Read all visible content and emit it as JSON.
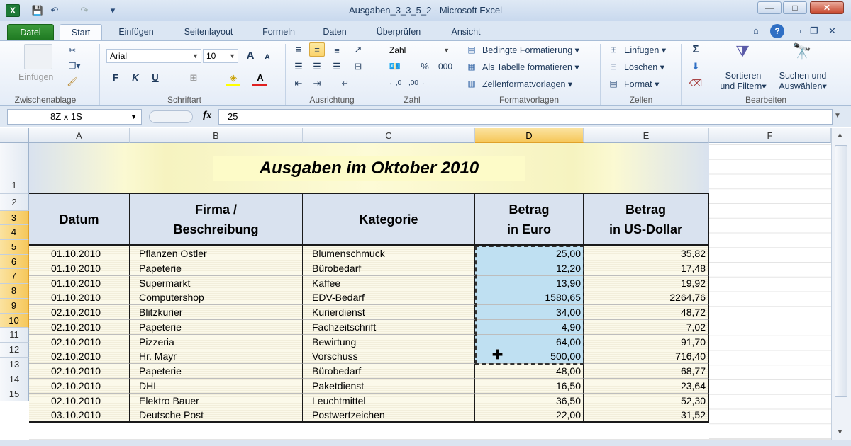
{
  "window": {
    "title": "Ausgaben_3_3_5_2  -  Microsoft Excel",
    "app_icon": "X"
  },
  "qat": {
    "save": "💾",
    "undo": "↶",
    "redo": "↷",
    "customize": "▾"
  },
  "winbtns": {
    "min": "—",
    "max": "□",
    "close": "✕"
  },
  "tabs": [
    "Datei",
    "Start",
    "Einfügen",
    "Seitenlayout",
    "Formeln",
    "Daten",
    "Überprüfen",
    "Ansicht"
  ],
  "ribbon": {
    "clipboard": {
      "paste": "Einfügen",
      "label": "Zwischenablage"
    },
    "font": {
      "name": "Arial",
      "size": "10",
      "bold": "F",
      "italic": "K",
      "underline": "U",
      "grow": "A",
      "shrink": "A",
      "label": "Schriftart"
    },
    "alignment": {
      "label": "Ausrichtung"
    },
    "number": {
      "format": "Zahl",
      "percent": "%",
      "thousands": "000",
      "label": "Zahl"
    },
    "styles": {
      "conditional": "Bedingte Formatierung",
      "table": "Als Tabelle formatieren",
      "cell_styles": "Zellenformatvorlagen",
      "label": "Formatvorlagen"
    },
    "cells": {
      "insert": "Einfügen",
      "delete": "Löschen",
      "format": "Format",
      "label": "Zellen"
    },
    "editing": {
      "sum": "Σ",
      "sort1": "Sortieren",
      "sort2": "und Filtern",
      "find1": "Suchen und",
      "find2": "Auswählen",
      "label": "Bearbeiten"
    }
  },
  "formula_bar": {
    "namebox": "8Z x 1S",
    "fx": "fx",
    "value": "25"
  },
  "columns": [
    "A",
    "B",
    "C",
    "D",
    "E",
    "F"
  ],
  "rows": [
    "1",
    "2",
    "3",
    "4",
    "5",
    "6",
    "7",
    "8",
    "9",
    "10",
    "11",
    "12",
    "13",
    "14",
    "15"
  ],
  "sheet": {
    "title": "Ausgaben im Oktober 2010",
    "headers": {
      "datum": "Datum",
      "firma1": "Firma /",
      "firma2": "Beschreibung",
      "kategorie": "Kategorie",
      "euro1": "Betrag",
      "euro2": "in Euro",
      "usd1": "Betrag",
      "usd2": "in US-Dollar"
    },
    "data": [
      [
        "01.10.2010",
        "Pflanzen Ostler",
        "Blumenschmuck",
        "25,00",
        "35,82"
      ],
      [
        "01.10.2010",
        "Papeterie",
        "Bürobedarf",
        "12,20",
        "17,48"
      ],
      [
        "01.10.2010",
        "Supermarkt",
        "Kaffee",
        "13,90",
        "19,92"
      ],
      [
        "01.10.2010",
        "Computershop",
        "EDV-Bedarf",
        "1580,65",
        "2264,76"
      ],
      [
        "02.10.2010",
        "Blitzkurier",
        "Kurierdienst",
        "34,00",
        "48,72"
      ],
      [
        "02.10.2010",
        "Papeterie",
        "Fachzeitschrift",
        "4,90",
        "7,02"
      ],
      [
        "02.10.2010",
        "Pizzeria",
        "Bewirtung",
        "64,00",
        "91,70"
      ],
      [
        "02.10.2010",
        "Hr. Mayr",
        "Vorschuss",
        "500,00",
        "716,40"
      ],
      [
        "02.10.2010",
        "Papeterie",
        "Bürobedarf",
        "48,00",
        "68,77"
      ],
      [
        "02.10.2010",
        "DHL",
        "Paketdienst",
        "16,50",
        "23,64"
      ],
      [
        "02.10.2010",
        "Elektro Bauer",
        "Leuchtmittel",
        "36,50",
        "52,30"
      ],
      [
        "03.10.2010",
        "Deutsche Post",
        "Postwertzeichen",
        "22,00",
        "31,52"
      ]
    ]
  },
  "colors": {
    "selection": "#bfe0f2",
    "header_fill": "#d9e2ef",
    "title_band": "#fdfbd6",
    "accent": "#1f7a22"
  }
}
